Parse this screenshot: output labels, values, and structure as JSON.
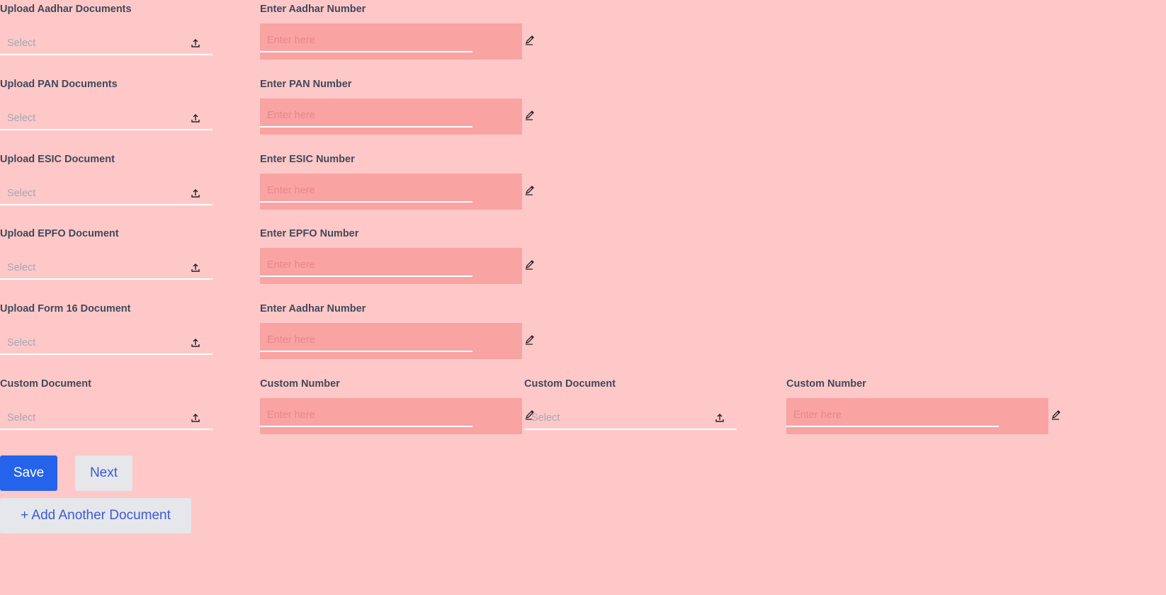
{
  "rows": [
    {
      "upload_label": "Upload Aadhar Documents",
      "upload_value": "Select",
      "number_label": "Enter Aadhar Number",
      "number_placeholder": "Enter here"
    },
    {
      "upload_label": "Upload PAN Documents",
      "upload_value": "Select",
      "number_label": "Enter PAN Number",
      "number_placeholder": "Enter here"
    },
    {
      "upload_label": "Upload ESIC Document",
      "upload_value": "Select",
      "number_label": "Enter ESIC Number",
      "number_placeholder": "Enter here"
    },
    {
      "upload_label": "Upload EPFO Document",
      "upload_value": "Select",
      "number_label": "Enter EPFO Number",
      "number_placeholder": "Enter here"
    },
    {
      "upload_label": "Upload Form 16 Document",
      "upload_value": "Select",
      "number_label": "Enter Aadhar Number",
      "number_placeholder": "Enter here"
    },
    {
      "upload_label": "Custom Document",
      "upload_value": "Select",
      "number_label": "Custom Number",
      "number_placeholder": "Enter here"
    }
  ],
  "extra_custom": {
    "upload_label": "Custom Document",
    "upload_value": "Select",
    "number_label": "Custom Number",
    "number_placeholder": "Enter here"
  },
  "buttons": {
    "save": "Save",
    "next": "Next",
    "add_document": "+ Add Another Document"
  },
  "colors": {
    "background": "#ffc8c8",
    "input_box": "#f9a3a3",
    "primary": "#2563eb",
    "secondary_bg": "#e5e7eb",
    "link_text": "#3b5bd6"
  },
  "icons": {
    "upload": "upload-icon",
    "edit": "pencil-icon"
  }
}
